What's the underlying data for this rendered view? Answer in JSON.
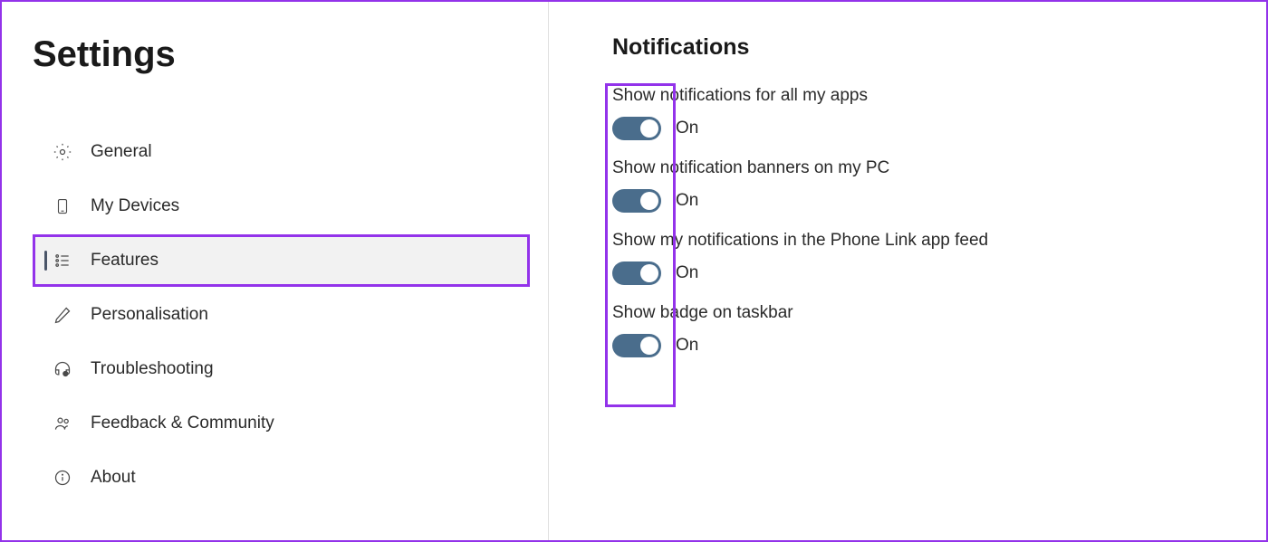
{
  "page": {
    "title": "Settings"
  },
  "sidebar": {
    "items": [
      {
        "id": "general",
        "label": "General",
        "icon": "gear"
      },
      {
        "id": "my-devices",
        "label": "My Devices",
        "icon": "phone"
      },
      {
        "id": "features",
        "label": "Features",
        "icon": "list",
        "active": true
      },
      {
        "id": "personalisation",
        "label": "Personalisation",
        "icon": "pen"
      },
      {
        "id": "troubleshooting",
        "label": "Troubleshooting",
        "icon": "headset-help"
      },
      {
        "id": "feedback-community",
        "label": "Feedback & Community",
        "icon": "people"
      },
      {
        "id": "about",
        "label": "About",
        "icon": "info"
      }
    ]
  },
  "content": {
    "section_title": "Notifications",
    "settings": [
      {
        "label": "Show notifications for all my apps",
        "state": "On",
        "enabled": true
      },
      {
        "label": "Show notification banners on my PC",
        "state": "On",
        "enabled": true
      },
      {
        "label": "Show my notifications in the Phone Link app feed",
        "state": "On",
        "enabled": true
      },
      {
        "label": "Show badge on taskbar",
        "state": "On",
        "enabled": true
      }
    ]
  }
}
